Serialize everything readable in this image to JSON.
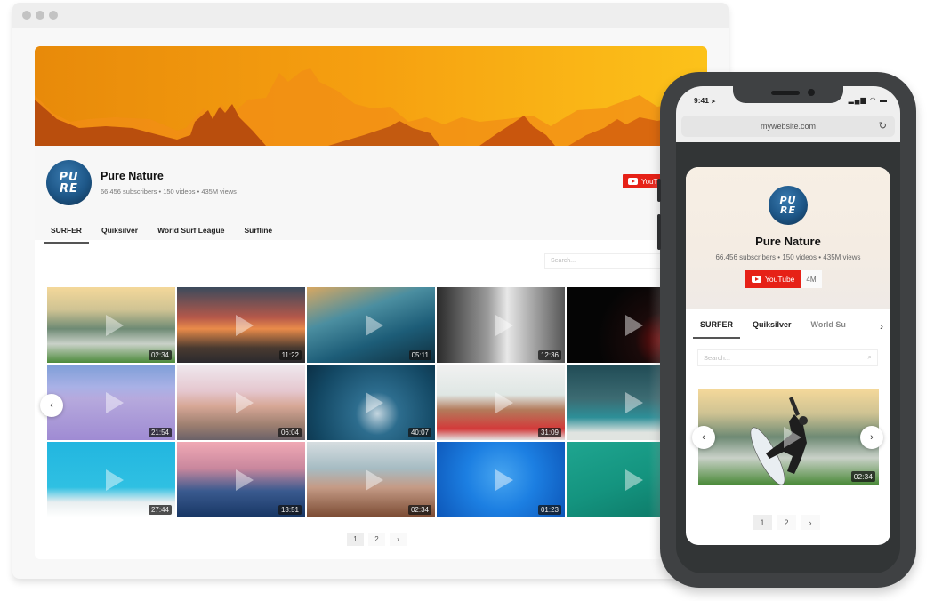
{
  "browser": {
    "window_dots": [
      "close",
      "minimize",
      "maximize"
    ]
  },
  "channel": {
    "logo_text_line1": "PU",
    "logo_text_line2": "RE",
    "name": "Pure Nature",
    "subscribers": "66,456 subscribers",
    "videos": "150 videos",
    "views": "435M views",
    "separator": "•",
    "youtube_button": "YouTube",
    "youtube_button_truncated": "YouTu",
    "youtube_count": "4M"
  },
  "tabs": [
    {
      "label": "SURFER",
      "active": true
    },
    {
      "label": "Quiksilver",
      "active": false
    },
    {
      "label": "World Surf League",
      "active": false
    },
    {
      "label": "Surfline",
      "active": false
    }
  ],
  "search": {
    "placeholder": "Search..."
  },
  "videos": [
    {
      "duration": "02:34",
      "subject": "surfer on wave"
    },
    {
      "duration": "11:22",
      "subject": "sunset street"
    },
    {
      "duration": "05:11",
      "subject": "ocean water"
    },
    {
      "duration": "12:36",
      "subject": "tattooed man"
    },
    {
      "duration": "",
      "subject": "night city with neon cross"
    },
    {
      "duration": "21:54",
      "subject": "salt flats"
    },
    {
      "duration": "06:04",
      "subject": "desert road"
    },
    {
      "duration": "40:07",
      "subject": "underwater diver"
    },
    {
      "duration": "31:09",
      "subject": "man under palm trees"
    },
    {
      "duration": "",
      "subject": "stormy beach"
    },
    {
      "duration": "27:44",
      "subject": "woman on beach"
    },
    {
      "duration": "13:51",
      "subject": "sunset silhouette"
    },
    {
      "duration": "02:34",
      "subject": "woman laughing"
    },
    {
      "duration": "01:23",
      "subject": "jellyfish"
    },
    {
      "duration": "",
      "subject": "shark in water"
    }
  ],
  "pagination": {
    "pages": [
      "1",
      "2"
    ],
    "current": "1",
    "next": "›"
  },
  "nav": {
    "prev": "‹",
    "next": "›"
  },
  "phone": {
    "time": "9:41",
    "location_arrow": "➤",
    "signal_icons": "▂▄▆ ◠ ▬",
    "url": "mywebsite.com",
    "reload": "↻",
    "tabs": [
      {
        "label": "SURFER",
        "active": true
      },
      {
        "label": "Quiksilver",
        "active": false
      },
      {
        "label": "World Su",
        "active": false
      }
    ],
    "tab_more": "›",
    "search_placeholder": "Search...",
    "search_icon": "⌕",
    "featured_video": {
      "duration": "02:34",
      "subject": "surfer on wave"
    }
  }
}
